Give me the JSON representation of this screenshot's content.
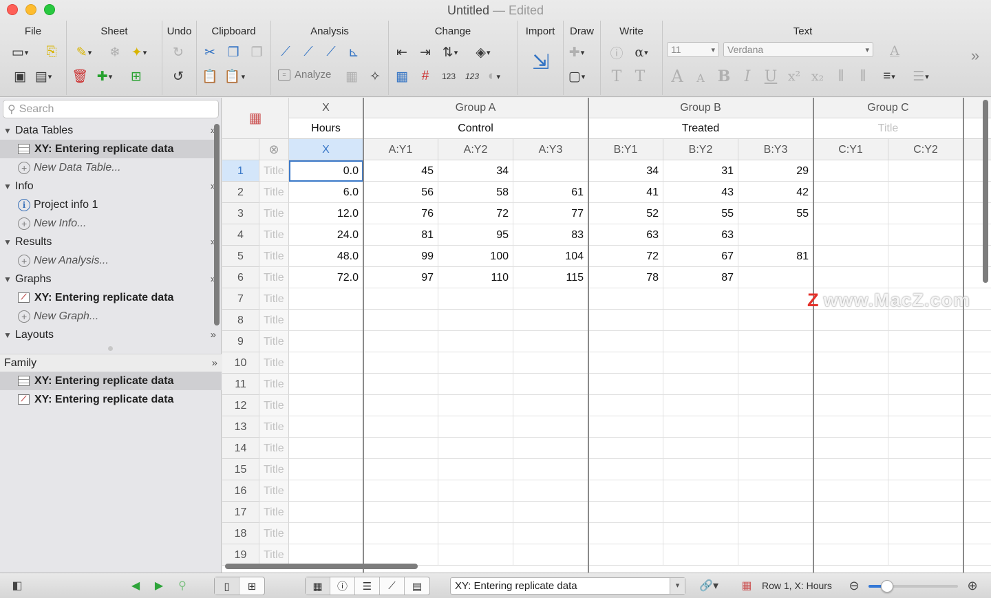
{
  "window": {
    "title": "Untitled",
    "title_suffix": " — Edited"
  },
  "toolbar": {
    "groups": {
      "file": "File",
      "sheet": "Sheet",
      "undo": "Undo",
      "clipboard": "Clipboard",
      "analysis": "Analysis",
      "change": "Change",
      "import": "Import",
      "draw": "Draw",
      "write": "Write",
      "text": "Text"
    },
    "analyze_label": "Analyze",
    "font_size": "11",
    "font_name": "Verdana"
  },
  "sidebar": {
    "search_placeholder": "Search",
    "data_tables": {
      "header": "Data Tables",
      "items": [
        "XY: Entering replicate data"
      ],
      "new": "New Data Table..."
    },
    "info": {
      "header": "Info",
      "items": [
        "Project info 1"
      ],
      "new": "New Info..."
    },
    "results": {
      "header": "Results",
      "new": "New Analysis..."
    },
    "graphs": {
      "header": "Graphs",
      "items": [
        "XY: Entering replicate data"
      ],
      "new": "New Graph..."
    },
    "layouts": {
      "header": "Layouts"
    },
    "family": {
      "header": "Family",
      "items": [
        "XY: Entering replicate data",
        "XY: Entering replicate data"
      ]
    }
  },
  "table": {
    "x_header": "X",
    "x_title": "Hours",
    "x_sub": "X",
    "groups": [
      {
        "name": "Group A",
        "title": "Control",
        "cols": [
          "A:Y1",
          "A:Y2",
          "A:Y3"
        ]
      },
      {
        "name": "Group B",
        "title": "Treated",
        "cols": [
          "B:Y1",
          "B:Y2",
          "B:Y3"
        ]
      },
      {
        "name": "Group C",
        "title": "Title",
        "cols": [
          "C:Y1",
          "C:Y2"
        ]
      }
    ],
    "row_title_placeholder": "Title",
    "rows": [
      {
        "n": "1",
        "x": "0.0",
        "v": [
          "45",
          "34",
          "",
          "34",
          "31",
          "29",
          "",
          ""
        ]
      },
      {
        "n": "2",
        "x": "6.0",
        "v": [
          "56",
          "58",
          "61",
          "41",
          "43",
          "42",
          "",
          ""
        ]
      },
      {
        "n": "3",
        "x": "12.0",
        "v": [
          "76",
          "72",
          "77",
          "52",
          "55",
          "55",
          "",
          ""
        ]
      },
      {
        "n": "4",
        "x": "24.0",
        "v": [
          "81",
          "95",
          "83",
          "63",
          "63",
          "",
          "",
          ""
        ]
      },
      {
        "n": "5",
        "x": "48.0",
        "v": [
          "99",
          "100",
          "104",
          "72",
          "67",
          "81",
          "",
          ""
        ]
      },
      {
        "n": "6",
        "x": "72.0",
        "v": [
          "97",
          "110",
          "115",
          "78",
          "87",
          "",
          "",
          ""
        ]
      },
      {
        "n": "7",
        "x": "",
        "v": [
          "",
          "",
          "",
          "",
          "",
          "",
          "",
          ""
        ]
      },
      {
        "n": "8",
        "x": "",
        "v": [
          "",
          "",
          "",
          "",
          "",
          "",
          "",
          ""
        ]
      },
      {
        "n": "9",
        "x": "",
        "v": [
          "",
          "",
          "",
          "",
          "",
          "",
          "",
          ""
        ]
      },
      {
        "n": "10",
        "x": "",
        "v": [
          "",
          "",
          "",
          "",
          "",
          "",
          "",
          ""
        ]
      },
      {
        "n": "11",
        "x": "",
        "v": [
          "",
          "",
          "",
          "",
          "",
          "",
          "",
          ""
        ]
      },
      {
        "n": "12",
        "x": "",
        "v": [
          "",
          "",
          "",
          "",
          "",
          "",
          "",
          ""
        ]
      },
      {
        "n": "13",
        "x": "",
        "v": [
          "",
          "",
          "",
          "",
          "",
          "",
          "",
          ""
        ]
      },
      {
        "n": "14",
        "x": "",
        "v": [
          "",
          "",
          "",
          "",
          "",
          "",
          "",
          ""
        ]
      },
      {
        "n": "15",
        "x": "",
        "v": [
          "",
          "",
          "",
          "",
          "",
          "",
          "",
          ""
        ]
      },
      {
        "n": "16",
        "x": "",
        "v": [
          "",
          "",
          "",
          "",
          "",
          "",
          "",
          ""
        ]
      },
      {
        "n": "17",
        "x": "",
        "v": [
          "",
          "",
          "",
          "",
          "",
          "",
          "",
          ""
        ]
      },
      {
        "n": "18",
        "x": "",
        "v": [
          "",
          "",
          "",
          "",
          "",
          "",
          "",
          ""
        ]
      },
      {
        "n": "19",
        "x": "",
        "v": [
          "",
          "",
          "",
          "",
          "",
          "",
          "",
          ""
        ]
      }
    ]
  },
  "watermark": "www.MacZ.com",
  "watermark_logo": "Z",
  "status": {
    "sheet_select": "XY: Entering replicate data",
    "cell_status": "Row 1, X: Hours"
  }
}
